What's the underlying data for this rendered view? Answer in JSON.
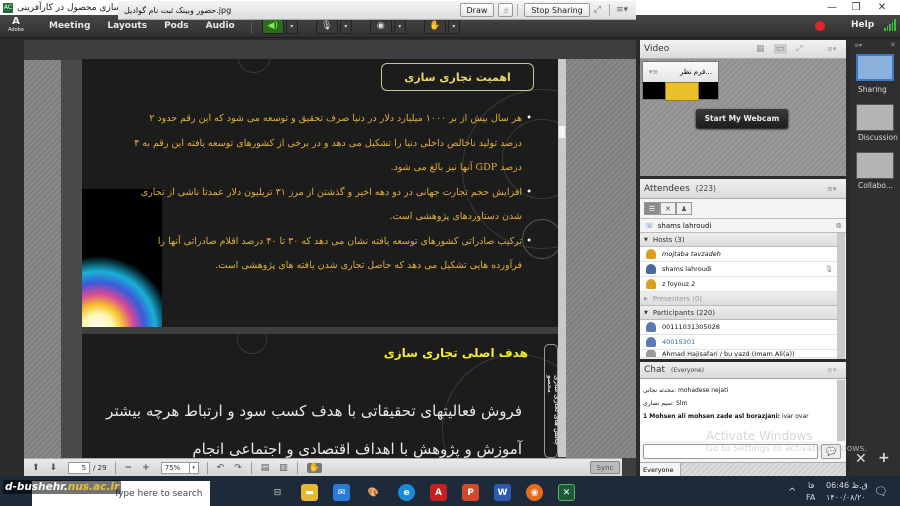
{
  "window": {
    "title": "وبینار آموزشی چالش های تجاری سازی محصول در کارآفرینی (Sharing) - Adobe Connect",
    "minimize": "—",
    "restore": "❐",
    "close": "✕"
  },
  "menubar": {
    "logo": "A",
    "logo_sub": "Adobe",
    "menus": [
      "Meeting",
      "Layouts",
      "Pods",
      "Audio"
    ],
    "speaker_icon": "speaker-on-icon",
    "mic_icon": "microphone-icon",
    "camera_icon": "webcam-icon",
    "status_icon": "raise-hand-icon",
    "dropdown": "▾",
    "help": "Help"
  },
  "share_pod": {
    "file_name": "حضور  وبینک ثبت نام گوادیل.jpg",
    "draw_label": "Draw",
    "stop_sharing_label": "Stop Sharing",
    "fullscreen_icon": "⤢",
    "menu_icon": "≡▾"
  },
  "slide1": {
    "title": "اهمیت تجاری سازی",
    "bullets": [
      "هر سال بیش از بر ۱۰۰۰ میلیارد دلار در دنیا صرف تحقیق و  توسعه می شود که این رقم حدود ۲ درصد تولید ناخالص داخلی دنیا را تشکیل می دهد و در برخی از کشورهای توسعه یافته این رقم به ۴ درصد GDP آنها نیز بالغ می شود.",
      "افزایش حجم تجارت جهانی در دو دهه اخیر و گذشتن از مرز ۳۱ تریلیون دلار عمدتا ناشی از تجاری شدن دستاوردهای پژوهشی است.",
      "ترکیب صادراتی کشورهای توسعه یافته نشان می دهد که ۳۰ تا ۴۰ درصد اقلام صادراتی آنها را فرآورده هایی تشکیل می دهد که حاصل تجاری شدن یافته های پژوهشی است."
    ]
  },
  "slide2": {
    "title": "هدف اصلی تجاری سازی",
    "body": "فروش فعالیتهای تحقیقاتی با هدف کسب سود و ارتباط هرچه بیشتر آموزش و پژوهش با اهداف اقتصادی و اجتماعی انجام",
    "side_label": "چالش های تجاری سازی محصو"
  },
  "footer": {
    "prev_icon": "⬆",
    "next_icon": "⬇",
    "current_page": "5",
    "total_pages": "/ 29",
    "zoom_out": "−",
    "zoom_in": "+",
    "zoom_level": "75%",
    "rotate_left": "↶",
    "rotate_right": "↷",
    "sync_label": "Sync"
  },
  "video_pod": {
    "title": "Video",
    "tile_name": "...قرم نظر",
    "start_webcam_label": "Start My Webcam"
  },
  "attendees": {
    "title": "Attendees",
    "count": "(223)",
    "search_user": "shams lahroudi",
    "groups": [
      {
        "label": "Hosts (3)",
        "expanded": true,
        "members": [
          {
            "name": "mojtaba tavzadeh",
            "style": "italic",
            "role": "host"
          },
          {
            "name": "shams lahroudi",
            "style": "normal",
            "role": "host",
            "mic": true
          },
          {
            "name": "z foyouz 2",
            "style": "normal",
            "role": "host"
          }
        ]
      },
      {
        "label": "Presenters (0)",
        "expanded": false,
        "members": []
      },
      {
        "label": "Participants (220)",
        "expanded": true,
        "members": [
          {
            "name": "00111031305028",
            "style": "normal",
            "role": "participant-phone"
          },
          {
            "name": "40015301",
            "style": "blue",
            "role": "participant"
          },
          {
            "name": "Ahmad Hajisafari / bu yazd (Imam Ali(a))",
            "style": "normal",
            "role": "participant"
          }
        ]
      }
    ]
  },
  "chat": {
    "title": "Chat",
    "audience": "(Everyone)",
    "messages": [
      {
        "sender": "mohadese nejati",
        "text": "محدثه نجاتی:"
      },
      {
        "sender": "Slm",
        "text": "سیم نصاری:"
      },
      {
        "sender": "1 Mohsen ali mohsen zade asl borazjani:",
        "text": "ivar ovar"
      }
    ],
    "tab": "Everyone"
  },
  "layouts": [
    {
      "label": "Sharing",
      "active": true
    },
    {
      "label": "Discussion",
      "active": false
    },
    {
      "label": "Collabo...",
      "active": false
    }
  ],
  "watermark": {
    "activate_title": "Activate Windows",
    "activate_sub": "Go to Settings to activate Windows.",
    "site_prefix": "d-bushehr.",
    "site_suffix": "nus.ac.ir"
  },
  "taskbar": {
    "search_placeholder": "Type here to search",
    "apps": [
      "task-view",
      "file-explorer",
      "mail",
      "paint",
      "edge",
      "acrobat",
      "powerpoint",
      "word",
      "firefox",
      "adobe-connect"
    ],
    "lang_top": "فا",
    "lang_bottom": "FA",
    "time": "06:46 ق.ظ",
    "date": "۱۴۰۰/۰۸/۲۰"
  }
}
